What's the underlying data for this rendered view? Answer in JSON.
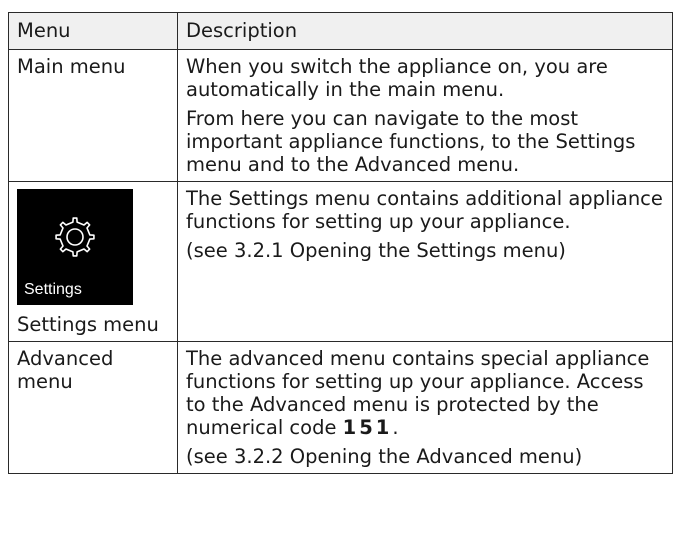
{
  "table": {
    "header": {
      "menu": "Menu",
      "description": "Description"
    },
    "rows": [
      {
        "menu": "Main menu",
        "paragraphs": [
          "When you switch the appliance on, you are automatically in the main menu.",
          "From here you can navigate to the most important appliance functions, to the Settings menu and to the Advanced menu."
        ]
      },
      {
        "icon": "gear-icon",
        "tile_caption": "Settings",
        "menu": "Settings menu",
        "paragraphs": [
          "The Settings menu contains additional appliance functions for setting up your appliance.",
          "(see 3.2.1 Opening the Settings menu)"
        ]
      },
      {
        "menu": "Advanced menu",
        "paragraph_intro": "The advanced menu contains special appliance functions for setting up your appliance. Access to the Advanced menu is protected by the numerical code",
        "code": "151",
        "paragraph_end": ".",
        "paragraph_ref": "(see 3.2.2 Opening the Advanced menu)"
      }
    ]
  }
}
